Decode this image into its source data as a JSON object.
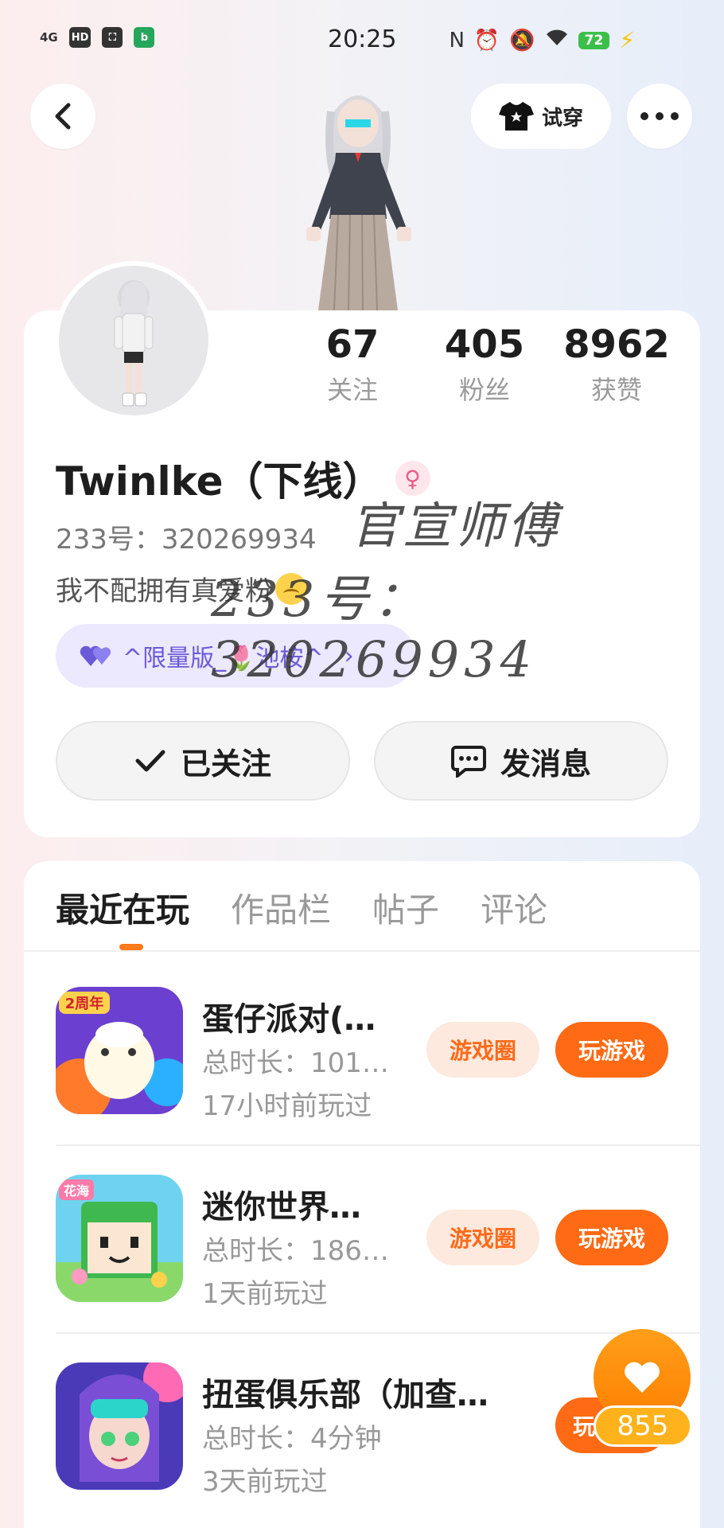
{
  "status_bar": {
    "time": "20:25",
    "signal": "4G",
    "chips": [
      "HD",
      "⛶",
      "b"
    ],
    "battery": "72"
  },
  "nav": {
    "tryon_label": "试穿"
  },
  "stats": [
    {
      "value": "67",
      "label": "关注"
    },
    {
      "value": "405",
      "label": "粉丝"
    },
    {
      "value": "8962",
      "label": "获赞"
    }
  ],
  "profile": {
    "username": "Twinlke（下线）",
    "user_id": "233号：320269934",
    "bio": "我不配拥有真爱粉",
    "badge": "^限量版_🌷池桉^",
    "watermark_line1": "官宣师傅",
    "watermark_line2": "233号：320269934"
  },
  "actions": {
    "follow_label": "已关注",
    "message_label": "发消息"
  },
  "tabs": [
    "最近在玩",
    "作品栏",
    "帖子",
    "评论"
  ],
  "games": [
    {
      "title": "蛋仔派对(…",
      "duration": "总时长：101…",
      "last_played": "17小时前玩过",
      "icon_badge": "2周年"
    },
    {
      "title": "迷你世界…",
      "duration": "总时长：186…",
      "last_played": "1天前玩过",
      "icon_badge": "花海"
    },
    {
      "title": "扭蛋俱乐部（加查…",
      "duration": "总时长：4分钟",
      "last_played": "3天前玩过",
      "icon_badge": ""
    }
  ],
  "game_buttons": {
    "circle_label": "游戏圈",
    "play_label": "玩游戏",
    "play_label_partial": "玩"
  },
  "like_float": {
    "count": "855"
  },
  "colors": {
    "accent": "#ff6a14",
    "badge_bg": "#ece8fd",
    "badge_text": "#6a5ad8"
  }
}
